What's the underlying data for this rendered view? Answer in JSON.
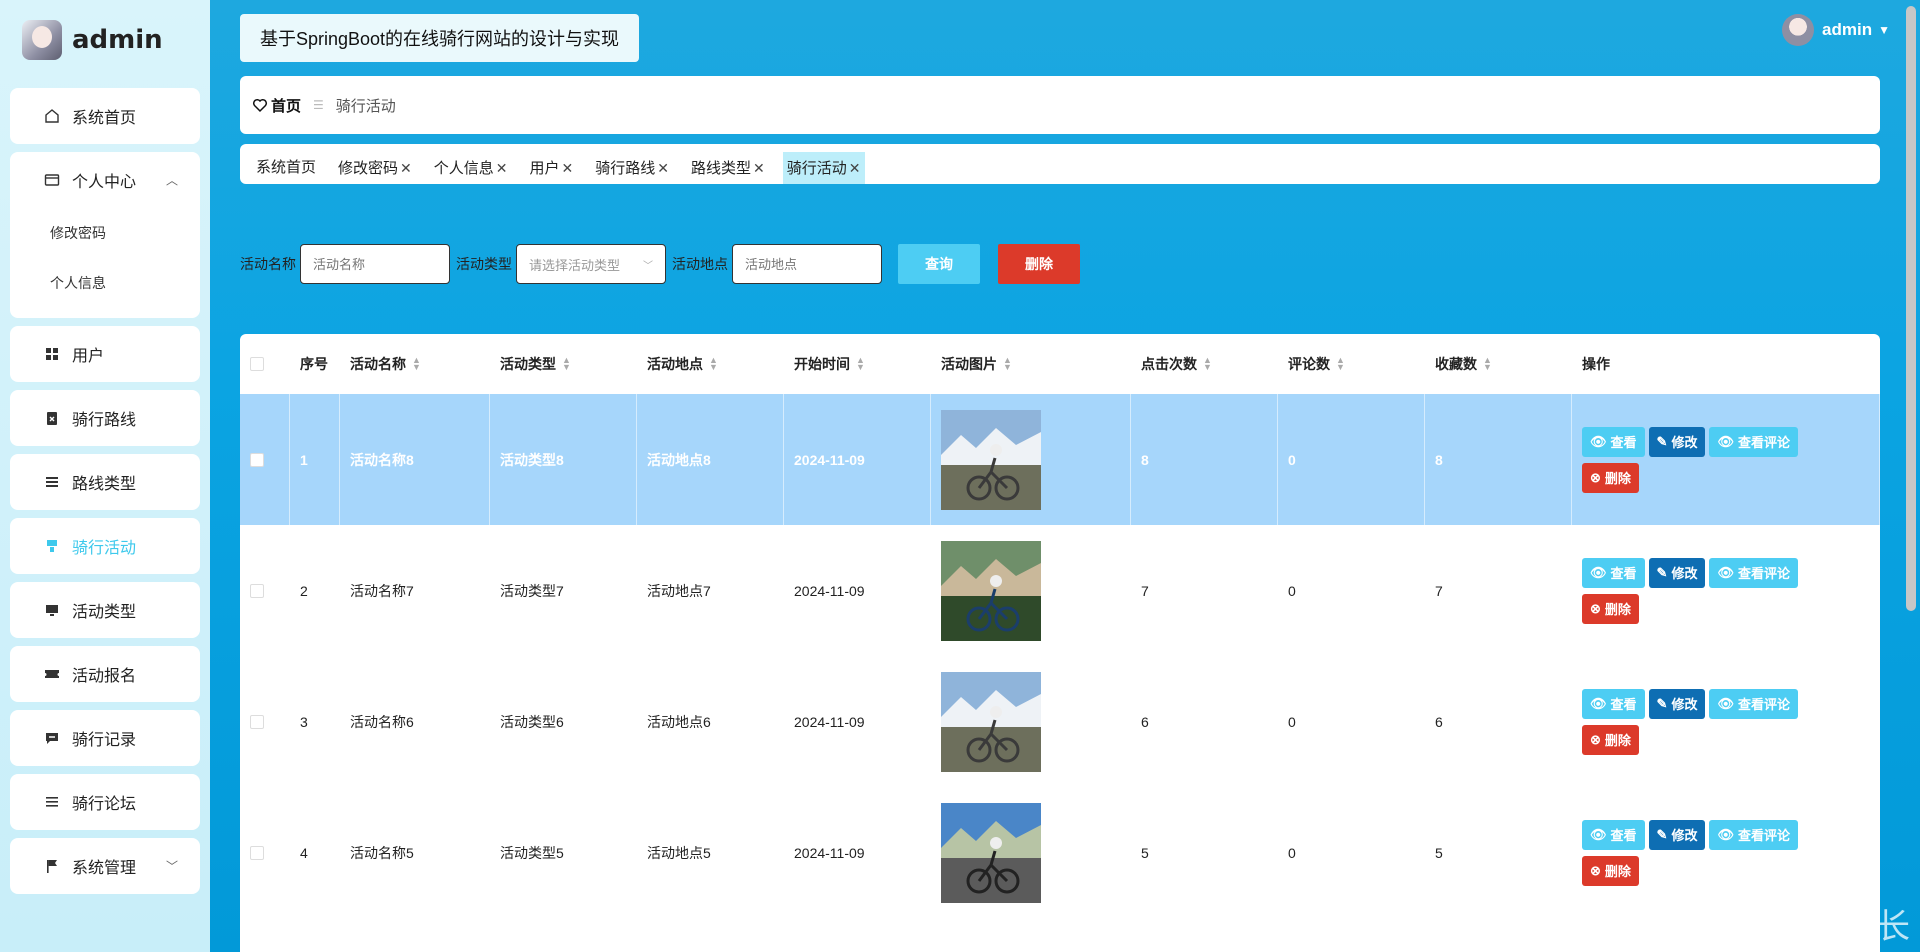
{
  "brand": {
    "name": "admin"
  },
  "sidebar": {
    "items": [
      {
        "label": "系统首页",
        "icon": "home-icon"
      },
      {
        "label": "个人中心",
        "icon": "card-icon",
        "expanded": true,
        "sub": [
          "修改密码",
          "个人信息"
        ]
      },
      {
        "label": "用户",
        "icon": "grid-icon"
      },
      {
        "label": "骑行路线",
        "icon": "clipboard-icon"
      },
      {
        "label": "路线类型",
        "icon": "list-icon"
      },
      {
        "label": "骑行活动",
        "icon": "brush-icon",
        "active": true
      },
      {
        "label": "活动类型",
        "icon": "monitor-icon"
      },
      {
        "label": "活动报名",
        "icon": "ticket-icon"
      },
      {
        "label": "骑行记录",
        "icon": "chat-icon"
      },
      {
        "label": "骑行论坛",
        "icon": "menu-icon"
      },
      {
        "label": "系统管理",
        "icon": "flag-icon"
      }
    ]
  },
  "header": {
    "title": "基于SpringBoot的在线骑行网站的设计与实现",
    "user": "admin"
  },
  "breadcrumb": {
    "home": "首页",
    "sep": "☰",
    "current": "骑行活动"
  },
  "tags": [
    {
      "label": "系统首页",
      "closable": false
    },
    {
      "label": "修改密码",
      "closable": true
    },
    {
      "label": "个人信息",
      "closable": true
    },
    {
      "label": "用户",
      "closable": true
    },
    {
      "label": "骑行路线",
      "closable": true
    },
    {
      "label": "路线类型",
      "closable": true
    },
    {
      "label": "骑行活动",
      "closable": true,
      "active": true
    }
  ],
  "search": {
    "name_label": "活动名称",
    "name_placeholder": "活动名称",
    "type_label": "活动类型",
    "type_placeholder": "请选择活动类型",
    "place_label": "活动地点",
    "place_placeholder": "活动地点",
    "query_label": "查询",
    "delete_label": "删除"
  },
  "table": {
    "headers": [
      "序号",
      "活动名称",
      "活动类型",
      "活动地点",
      "开始时间",
      "活动图片",
      "点击次数",
      "评论数",
      "收藏数",
      "操作"
    ],
    "rows": [
      {
        "no": "1",
        "name": "活动名称8",
        "type": "活动类型8",
        "place": "活动地点8",
        "start": "2024-11-09",
        "clicks": "8",
        "comments": "0",
        "favs": "8",
        "selected": true
      },
      {
        "no": "2",
        "name": "活动名称7",
        "type": "活动类型7",
        "place": "活动地点7",
        "start": "2024-11-09",
        "clicks": "7",
        "comments": "0",
        "favs": "7"
      },
      {
        "no": "3",
        "name": "活动名称6",
        "type": "活动类型6",
        "place": "活动地点6",
        "start": "2024-11-09",
        "clicks": "6",
        "comments": "0",
        "favs": "6"
      },
      {
        "no": "4",
        "name": "活动名称5",
        "type": "活动类型5",
        "place": "活动地点5",
        "start": "2024-11-09",
        "clicks": "5",
        "comments": "0",
        "favs": "5"
      }
    ],
    "ops": {
      "view": "查看",
      "edit": "修改",
      "comments": "查看评论",
      "delete": "删除"
    }
  },
  "watermark": "CSDN @计算机程序猿学长",
  "colors": {
    "accent": "#3ec9ec",
    "danger": "#dc3a2a",
    "edit": "#0e6eb3",
    "bg": "#0ba4e2"
  }
}
